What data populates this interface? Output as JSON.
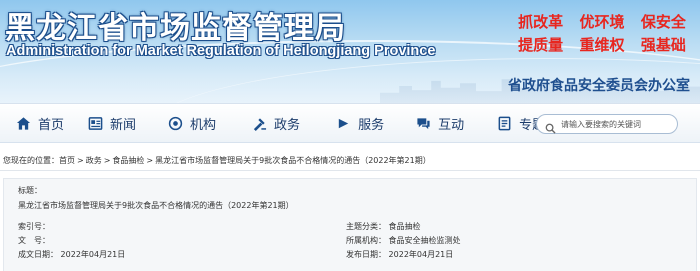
{
  "header": {
    "title": "黑龙江省市场监督管理局",
    "subtitle": "Administration for Market Regulation of Heilongjiang Province",
    "slogans": [
      "抓改革",
      "优环境",
      "保安全",
      "提质量",
      "重维权",
      "强基础"
    ],
    "committee": "省政府食品安全委员会办公室",
    "colors": {
      "slogan": "#e8261f",
      "banner": "#8fc7ee",
      "nav_text": "#1c3c6b"
    }
  },
  "nav": {
    "items": [
      {
        "label": "首页",
        "icon": "home-icon"
      },
      {
        "label": "新闻",
        "icon": "news-icon"
      },
      {
        "label": "机构",
        "icon": "institution-icon"
      },
      {
        "label": "政务",
        "icon": "government-affairs-icon"
      },
      {
        "label": "服务",
        "icon": "service-icon"
      },
      {
        "label": "互动",
        "icon": "interaction-icon"
      },
      {
        "label": "专题",
        "icon": "topic-icon"
      }
    ],
    "search_placeholder": "请输入要搜索的关键词"
  },
  "breadcrumb": {
    "prefix": "您现在的位置：",
    "items": [
      "首页",
      "政务",
      "食品抽检",
      "黑龙江省市场监督管理局关于9批次食品不合格情况的通告（2022年第21期）"
    ],
    "separator": ">"
  },
  "info": {
    "title_label": "标题：",
    "title_value": "黑龙江省市场监督管理局关于9批次食品不合格情况的通告（2022年第21期）",
    "index_label": "索引号：",
    "index_value": "",
    "docno_label": "文　号：",
    "docno_value": "",
    "created_label": "成文日期：",
    "created_value": "2022年04月21日",
    "category_label": "主题分类：",
    "category_value": "食品抽检",
    "org_label": "所属机构：",
    "org_value": "食品安全抽检监测处",
    "publish_label": "发布日期：",
    "publish_value": "2022年04月21日"
  }
}
